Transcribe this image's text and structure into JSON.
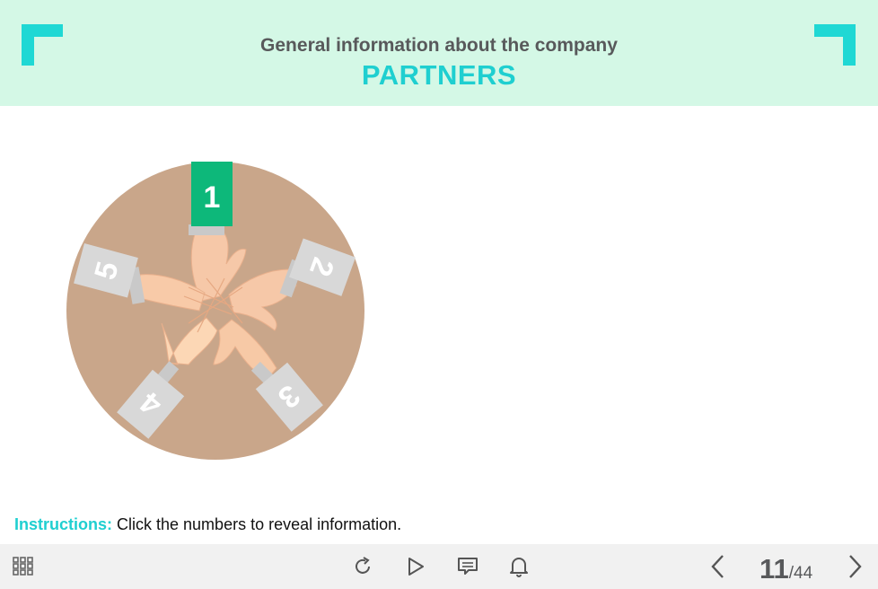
{
  "header": {
    "subtitle": "General information about the company",
    "title": "PARTNERS",
    "accent_color": "#1fcfd0",
    "background_color": "#d4f8e6"
  },
  "hotspots": [
    {
      "label": "1",
      "state": "active",
      "color": "#0db87a"
    },
    {
      "label": "2",
      "state": "inactive",
      "color": "#d8d8d8"
    },
    {
      "label": "3",
      "state": "inactive",
      "color": "#d8d8d8"
    },
    {
      "label": "4",
      "state": "inactive",
      "color": "#d8d8d8"
    },
    {
      "label": "5",
      "state": "inactive",
      "color": "#d8d8d8"
    }
  ],
  "instructions": {
    "label": "Instructions:",
    "text": " Click the numbers to reveal information."
  },
  "toolbar": {
    "menu_icon": "grid-icon",
    "replay_icon": "replay-icon",
    "play_icon": "play-icon",
    "notes_icon": "comment-icon",
    "notifications_icon": "bell-icon",
    "prev_icon": "chevron-left-icon",
    "next_icon": "chevron-right-icon",
    "page_current": "11",
    "page_total": "/44"
  }
}
